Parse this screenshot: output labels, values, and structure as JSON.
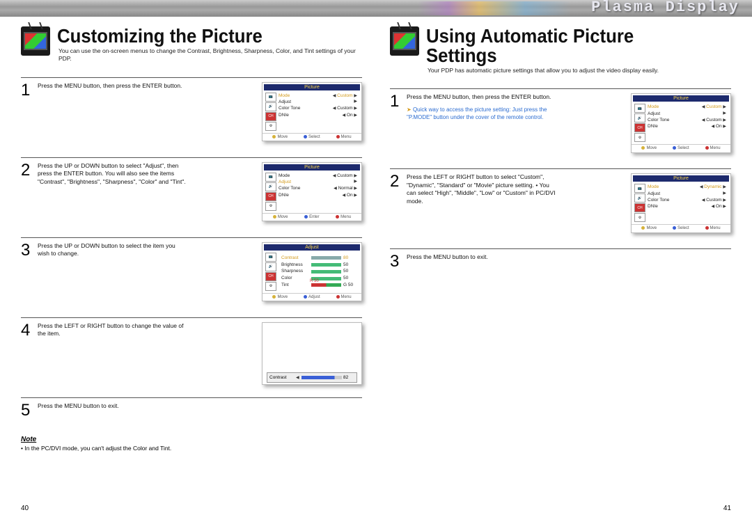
{
  "brand": "Plasma Display",
  "left_page": {
    "title": "Customizing the Picture",
    "intro": "You can use the on-screen menus to change the Contrast, Brightness, Sharpness, Color, and Tint settings of your PDP.",
    "steps": [
      {
        "num": "1",
        "text": "Press the MENU button, then press the ENTER button."
      },
      {
        "num": "2",
        "text": "Press the UP or DOWN button to select \"Adjust\", then press the ENTER button.\nYou will also see the items \"Contrast\", \"Brightness\", \"Sharpness\", \"Color\" and \"Tint\"."
      },
      {
        "num": "3",
        "text": "Press the UP or DOWN button to select the item you wish to change."
      },
      {
        "num": "4",
        "text": "Press the LEFT or RIGHT button to change the value of the item."
      },
      {
        "num": "5",
        "text": "Press the MENU button to exit."
      }
    ],
    "note_title": "Note",
    "note_body": "• In the PC/DVI mode, you can't adjust the Color and Tint.",
    "page_num": "40"
  },
  "right_page": {
    "title": "Using Automatic Picture Settings",
    "intro": "Your PDP has automatic picture settings that allow you to adjust the video display easily.",
    "steps": [
      {
        "num": "1",
        "text": "Press the MENU button, then press the ENTER button.",
        "tip": "Quick way to access the picture setting: Just press the \"P.MODE\" button under the cover of the remote control."
      },
      {
        "num": "2",
        "text": "Press the LEFT or RIGHT button to select \"Custom\", \"Dynamic\", \"Standard\" or \"Movie\" picture setting.\n• You can select \"High\", \"Middle\", \"Low\" or \"Custom\" in PC/DVI mode."
      },
      {
        "num": "3",
        "text": "Press the MENU button to exit."
      }
    ],
    "page_num": "41"
  },
  "osd": {
    "picture_title": "Picture",
    "adjust_title": "Adjust",
    "menu1": {
      "rows": [
        {
          "label": "Mode",
          "val": "Custom",
          "sel": true
        },
        {
          "label": "Adjust",
          "val": ""
        },
        {
          "label": "Color Tone",
          "val": "Custom"
        },
        {
          "label": "DNIe",
          "val": "On"
        }
      ],
      "foot": [
        "Move",
        "Select",
        "Menu"
      ]
    },
    "menu2": {
      "rows": [
        {
          "label": "Mode",
          "val": "Custom"
        },
        {
          "label": "Adjust",
          "val": "",
          "sel": true
        },
        {
          "label": "Color Tone",
          "val": "Normal"
        },
        {
          "label": "DNIe",
          "val": "On"
        }
      ],
      "foot": [
        "Move",
        "Enter",
        "Menu"
      ]
    },
    "menu_r2": {
      "rows": [
        {
          "label": "Mode",
          "val": "Dynamic",
          "sel": true
        },
        {
          "label": "Adjust",
          "val": ""
        },
        {
          "label": "Color Tone",
          "val": "Custom"
        },
        {
          "label": "DNIe",
          "val": "On"
        }
      ],
      "foot": [
        "Move",
        "Select",
        "Menu"
      ]
    },
    "adjust": {
      "rows": [
        {
          "label": "Contrast",
          "val": "80",
          "sel": true
        },
        {
          "label": "Brightness",
          "val": "50"
        },
        {
          "label": "Sharpness",
          "val": "50"
        },
        {
          "label": "Color",
          "val": "50"
        },
        {
          "label": "Tint",
          "val": "G 50",
          "tint": "R 50"
        }
      ],
      "foot": [
        "Move",
        "Adjust",
        "Menu"
      ]
    },
    "slider": {
      "label": "Contrast",
      "val": "82"
    }
  }
}
